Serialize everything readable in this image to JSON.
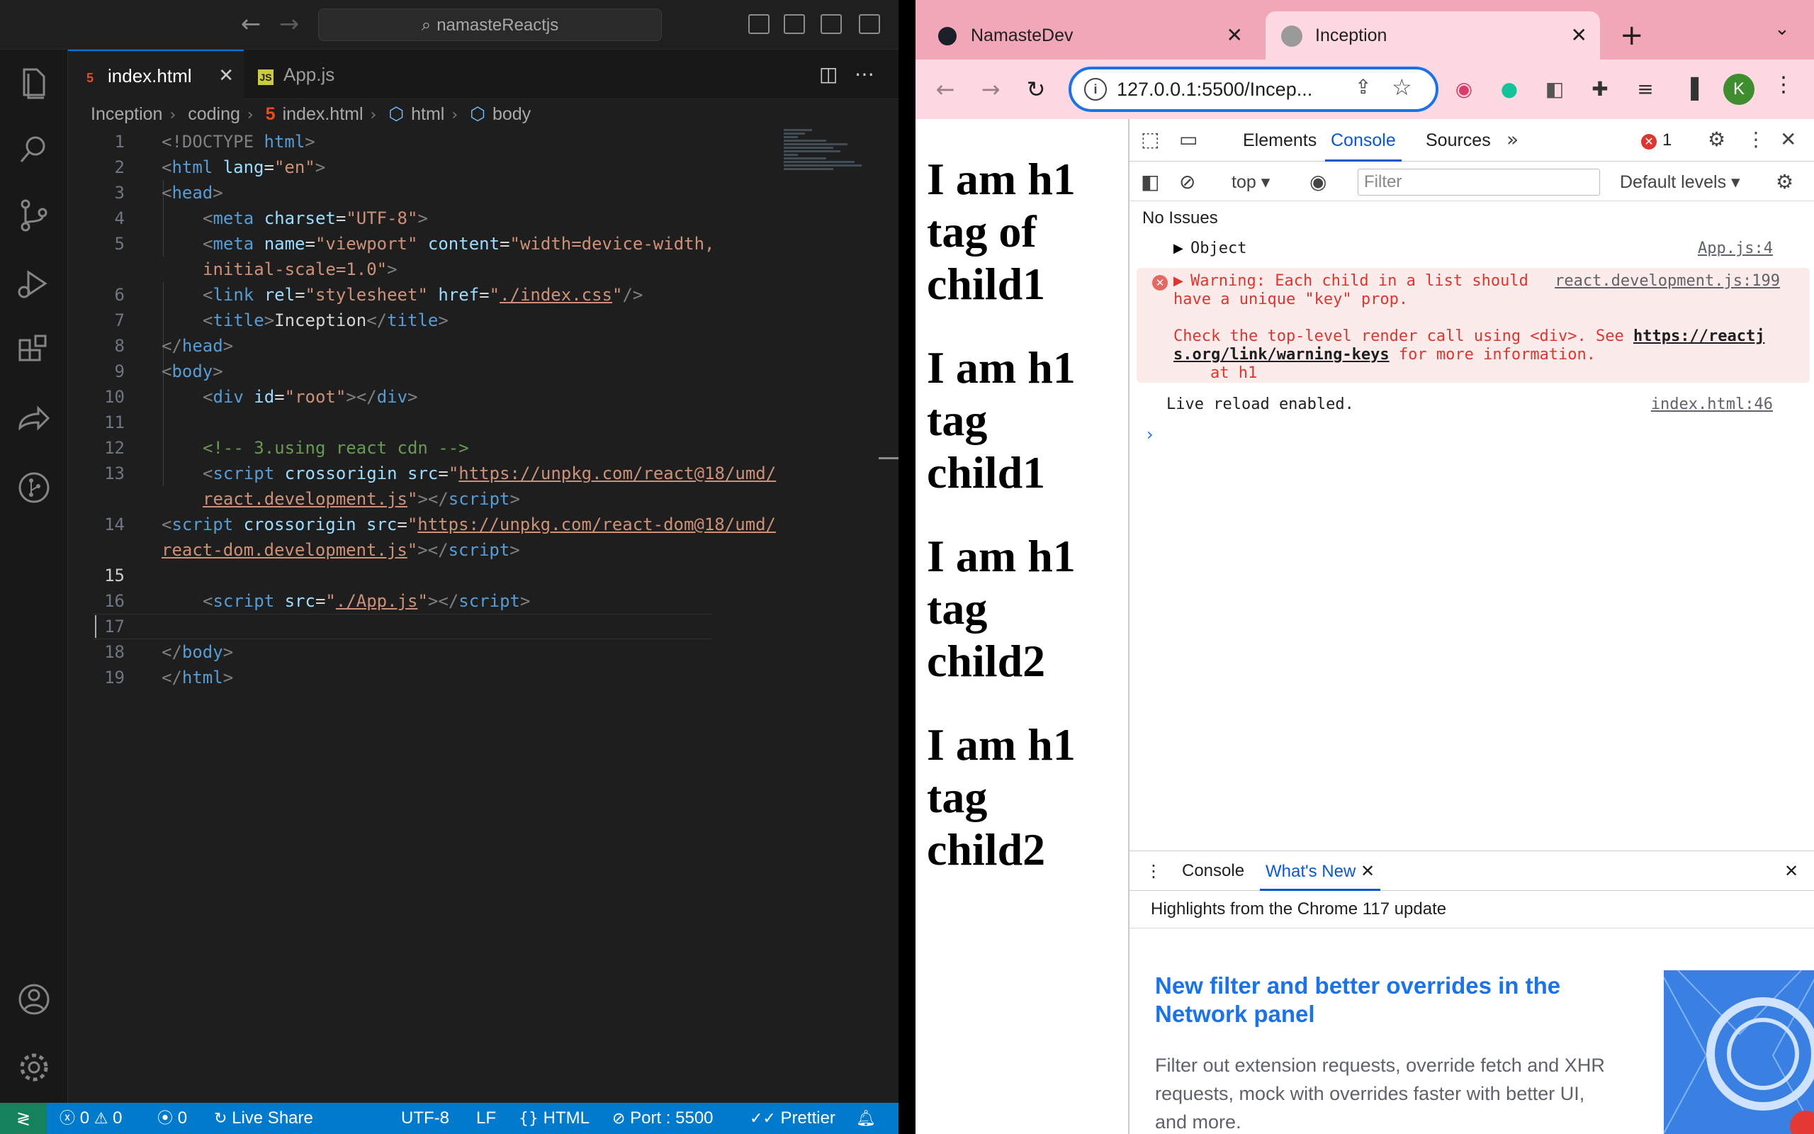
{
  "vscode": {
    "search_text": "namasteReactjs",
    "tabs": [
      {
        "label": "index.html",
        "icon": "html5-file-icon",
        "active": true
      },
      {
        "label": "App.js",
        "icon": "js-file-icon",
        "active": false
      }
    ],
    "breadcrumb": [
      "Inception",
      "coding",
      "index.html",
      "html",
      "body"
    ],
    "line_numbers": [
      "1",
      "2",
      "3",
      "4",
      "5",
      "",
      "6",
      "7",
      "8",
      "9",
      "10",
      "11",
      "12",
      "13",
      "",
      "14",
      "",
      "15",
      "16",
      "17",
      "18",
      "19"
    ],
    "code": {
      "l1_doctype": "<!DOCTYPE",
      "l1_html": "html",
      "l2_tag": "html",
      "l2_attr": "lang",
      "l2_val": "\"en\"",
      "l3_tag": "head",
      "l4_tag": "meta",
      "l4_attr": "charset",
      "l4_val": "\"UTF-8\"",
      "l5_tag": "meta",
      "l5_attr1": "name",
      "l5_val1": "\"viewport\"",
      "l5_attr2": "content",
      "l5_val2a": "\"width=device-width,",
      "l5_val2b": "initial-scale=1.0\"",
      "l6_tag": "link",
      "l6_attr1": "rel",
      "l6_val1": "\"stylesheet\"",
      "l6_attr2": "href",
      "l6_val2": "./index.css",
      "l7_tag": "title",
      "l7_text": "Inception",
      "l8_tag": "head",
      "l9_tag": "body",
      "l10_tag": "div",
      "l10_attr": "id",
      "l10_val": "\"root\"",
      "l12_comment": "<!-- 3.using react cdn -->",
      "l13_tag": "script",
      "l13_attr1": "crossorigin",
      "l13_attr2": "src",
      "l13_url_a": "https://unpkg.com/react@18/umd/",
      "l13_url_b": "react.development.js",
      "l14_tag": "script",
      "l14_attr1": "crossorigin",
      "l14_attr2": "src",
      "l14_url_a": "https://unpkg.com/react-dom@18/umd/",
      "l14_url_b": "react-dom.development.js",
      "l16_tag": "script",
      "l16_attr": "src",
      "l16_val": "./App.js",
      "l18_tag": "body",
      "l19_tag": "html"
    },
    "status": {
      "errors": "0",
      "warnings": "0",
      "ports": "0",
      "live_share": "Live Share",
      "encoding": "UTF-8",
      "eol": "LF",
      "language": "HTML",
      "port": "Port : 5500",
      "prettier": "Prettier"
    }
  },
  "chrome": {
    "tabs": [
      {
        "title": "NamasteDev",
        "active": false
      },
      {
        "title": "Inception",
        "active": true
      }
    ],
    "url": "127.0.0.1:5500/Incep...",
    "profile_initial": "K",
    "page_headings": [
      "I am h1 tag of child1",
      "I am h1 tag child1",
      "I am h1 tag child2",
      "I am h1 tag child2"
    ],
    "devtools": {
      "tabs": [
        "Elements",
        "Console",
        "Sources"
      ],
      "active_tab": "Console",
      "error_count": "1",
      "context": "top",
      "filter_placeholder": "Filter",
      "levels": "Default levels",
      "no_issues": "No Issues",
      "console": {
        "object_label": "Object",
        "object_src": "App.js:4",
        "warn_line1": "Warning: Each child in a list should",
        "warn_line2": "have a unique \"key\" prop.",
        "warn_src": "react.development.js:199",
        "warn_check": "Check the top-level render call using <div>. See",
        "warn_link_a": "https://reactj",
        "warn_link_b": "s.org/link/warning-keys",
        "warn_more": "for more information.",
        "warn_at": "at h1",
        "live_reload": "Live reload enabled.",
        "live_src": "index.html:46"
      },
      "drawer": {
        "tabs": [
          "Console",
          "What's New"
        ],
        "active_tab": "What's New",
        "highlights": "Highlights from the Chrome 117 update",
        "feature_title": "New filter and better overrides in the Network panel",
        "feature_desc": "Filter out extension requests, override fetch and XHR requests, mock with overrides faster with better UI, and more."
      }
    }
  }
}
